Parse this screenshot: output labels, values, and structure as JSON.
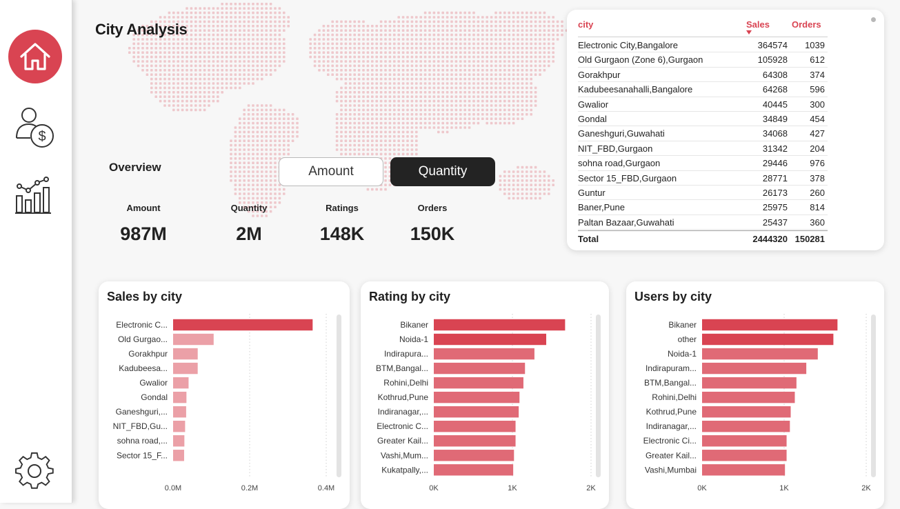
{
  "page": {
    "title": "City Analysis"
  },
  "nav": {
    "items": [
      {
        "name": "home",
        "icon": "home-icon",
        "active": true
      },
      {
        "name": "customers",
        "icon": "user-dollar-icon",
        "active": false
      },
      {
        "name": "trends",
        "icon": "bar-line-chart-icon",
        "active": false
      }
    ],
    "bottom": {
      "name": "settings",
      "icon": "gear-icon"
    }
  },
  "overview": {
    "title": "Overview",
    "toggle": {
      "amount": "Amount",
      "quantity": "Quantity",
      "selected": "quantity"
    },
    "kpis": [
      {
        "label": "Amount",
        "value": "987M"
      },
      {
        "label": "Quantity",
        "value": "2M"
      },
      {
        "label": "Ratings",
        "value": "148K"
      },
      {
        "label": "Orders",
        "value": "150K"
      }
    ]
  },
  "table": {
    "columns": [
      "city",
      "Sales",
      "Orders"
    ],
    "sort_column": "Sales",
    "rows": [
      {
        "city": "Electronic City,Bangalore",
        "sales": "364574",
        "orders": "1039"
      },
      {
        "city": "Old Gurgaon (Zone 6),Gurgaon",
        "sales": "105928",
        "orders": "612"
      },
      {
        "city": "Gorakhpur",
        "sales": "64308",
        "orders": "374"
      },
      {
        "city": "Kadubeesanahalli,Bangalore",
        "sales": "64268",
        "orders": "596"
      },
      {
        "city": "Gwalior",
        "sales": "40445",
        "orders": "300"
      },
      {
        "city": "Gondal",
        "sales": "34849",
        "orders": "454"
      },
      {
        "city": "Ganeshguri,Guwahati",
        "sales": "34068",
        "orders": "427"
      },
      {
        "city": "NIT_FBD,Gurgaon",
        "sales": "31342",
        "orders": "204"
      },
      {
        "city": "sohna road,Gurgaon",
        "sales": "29446",
        "orders": "976"
      },
      {
        "city": "Sector 15_FBD,Gurgaon",
        "sales": "28771",
        "orders": "378"
      },
      {
        "city": "Guntur",
        "sales": "26173",
        "orders": "260"
      },
      {
        "city": "Baner,Pune",
        "sales": "25975",
        "orders": "814"
      },
      {
        "city": "Paltan Bazaar,Guwahati",
        "sales": "25437",
        "orders": "360"
      }
    ],
    "total": {
      "label": "Total",
      "sales": "2444320",
      "orders": "150281"
    }
  },
  "charts": {
    "sales": {
      "title": "Sales by city"
    },
    "rating": {
      "title": "Rating by city"
    },
    "users": {
      "title": "Users by city"
    }
  },
  "colors": {
    "accent": "#d94452",
    "bar_primary": "#d94452",
    "bar_secondary": "#e06a76",
    "bar_faded": "#eba0a7",
    "map_dot": "#eec8cc"
  },
  "chart_data": [
    {
      "type": "bar",
      "orientation": "horizontal",
      "title": "Sales by city",
      "categories": [
        "Electronic C...",
        "Old Gurgao...",
        "Gorakhpur",
        "Kadubeesa...",
        "Gwalior",
        "Gondal",
        "Ganeshguri,...",
        "NIT_FBD,Gu...",
        "sohna road,...",
        "Sector 15_F..."
      ],
      "values": [
        364574,
        105928,
        64308,
        64268,
        40445,
        34849,
        34068,
        31342,
        29446,
        28771
      ],
      "highlighted_index": 0,
      "xlim": [
        0,
        400000
      ],
      "xticks": [
        0,
        200000,
        400000
      ],
      "xtick_labels": [
        "0.0M",
        "0.2M",
        "0.4M"
      ],
      "grid": true
    },
    {
      "type": "bar",
      "orientation": "horizontal",
      "title": "Rating by city",
      "categories": [
        "Bikaner",
        "Noida-1",
        "Indirapura...",
        "BTM,Bangal...",
        "Rohini,Delhi",
        "Kothrud,Pune",
        "Indiranagar,...",
        "Electronic C...",
        "Greater Kail...",
        "Vashi,Mum...",
        "Kukatpally,..."
      ],
      "values": [
        1670,
        1430,
        1280,
        1160,
        1140,
        1090,
        1080,
        1040,
        1040,
        1020,
        1010
      ],
      "xlim": [
        0,
        2000
      ],
      "xticks": [
        0,
        1000,
        2000
      ],
      "xtick_labels": [
        "0K",
        "1K",
        "2K"
      ],
      "grid": true
    },
    {
      "type": "bar",
      "orientation": "horizontal",
      "title": "Users by city",
      "categories": [
        "Bikaner",
        "other",
        "Noida-1",
        "Indirapuram...",
        "BTM,Bangal...",
        "Rohini,Delhi",
        "Kothrud,Pune",
        "Indiranagar,...",
        "Electronic Ci...",
        "Greater Kail...",
        "Vashi,Mumbai"
      ],
      "values": [
        1650,
        1600,
        1410,
        1270,
        1150,
        1130,
        1080,
        1070,
        1030,
        1030,
        1010
      ],
      "xlim": [
        0,
        2000
      ],
      "xticks": [
        0,
        1000,
        2000
      ],
      "xtick_labels": [
        "0K",
        "1K",
        "2K"
      ],
      "grid": true
    }
  ]
}
